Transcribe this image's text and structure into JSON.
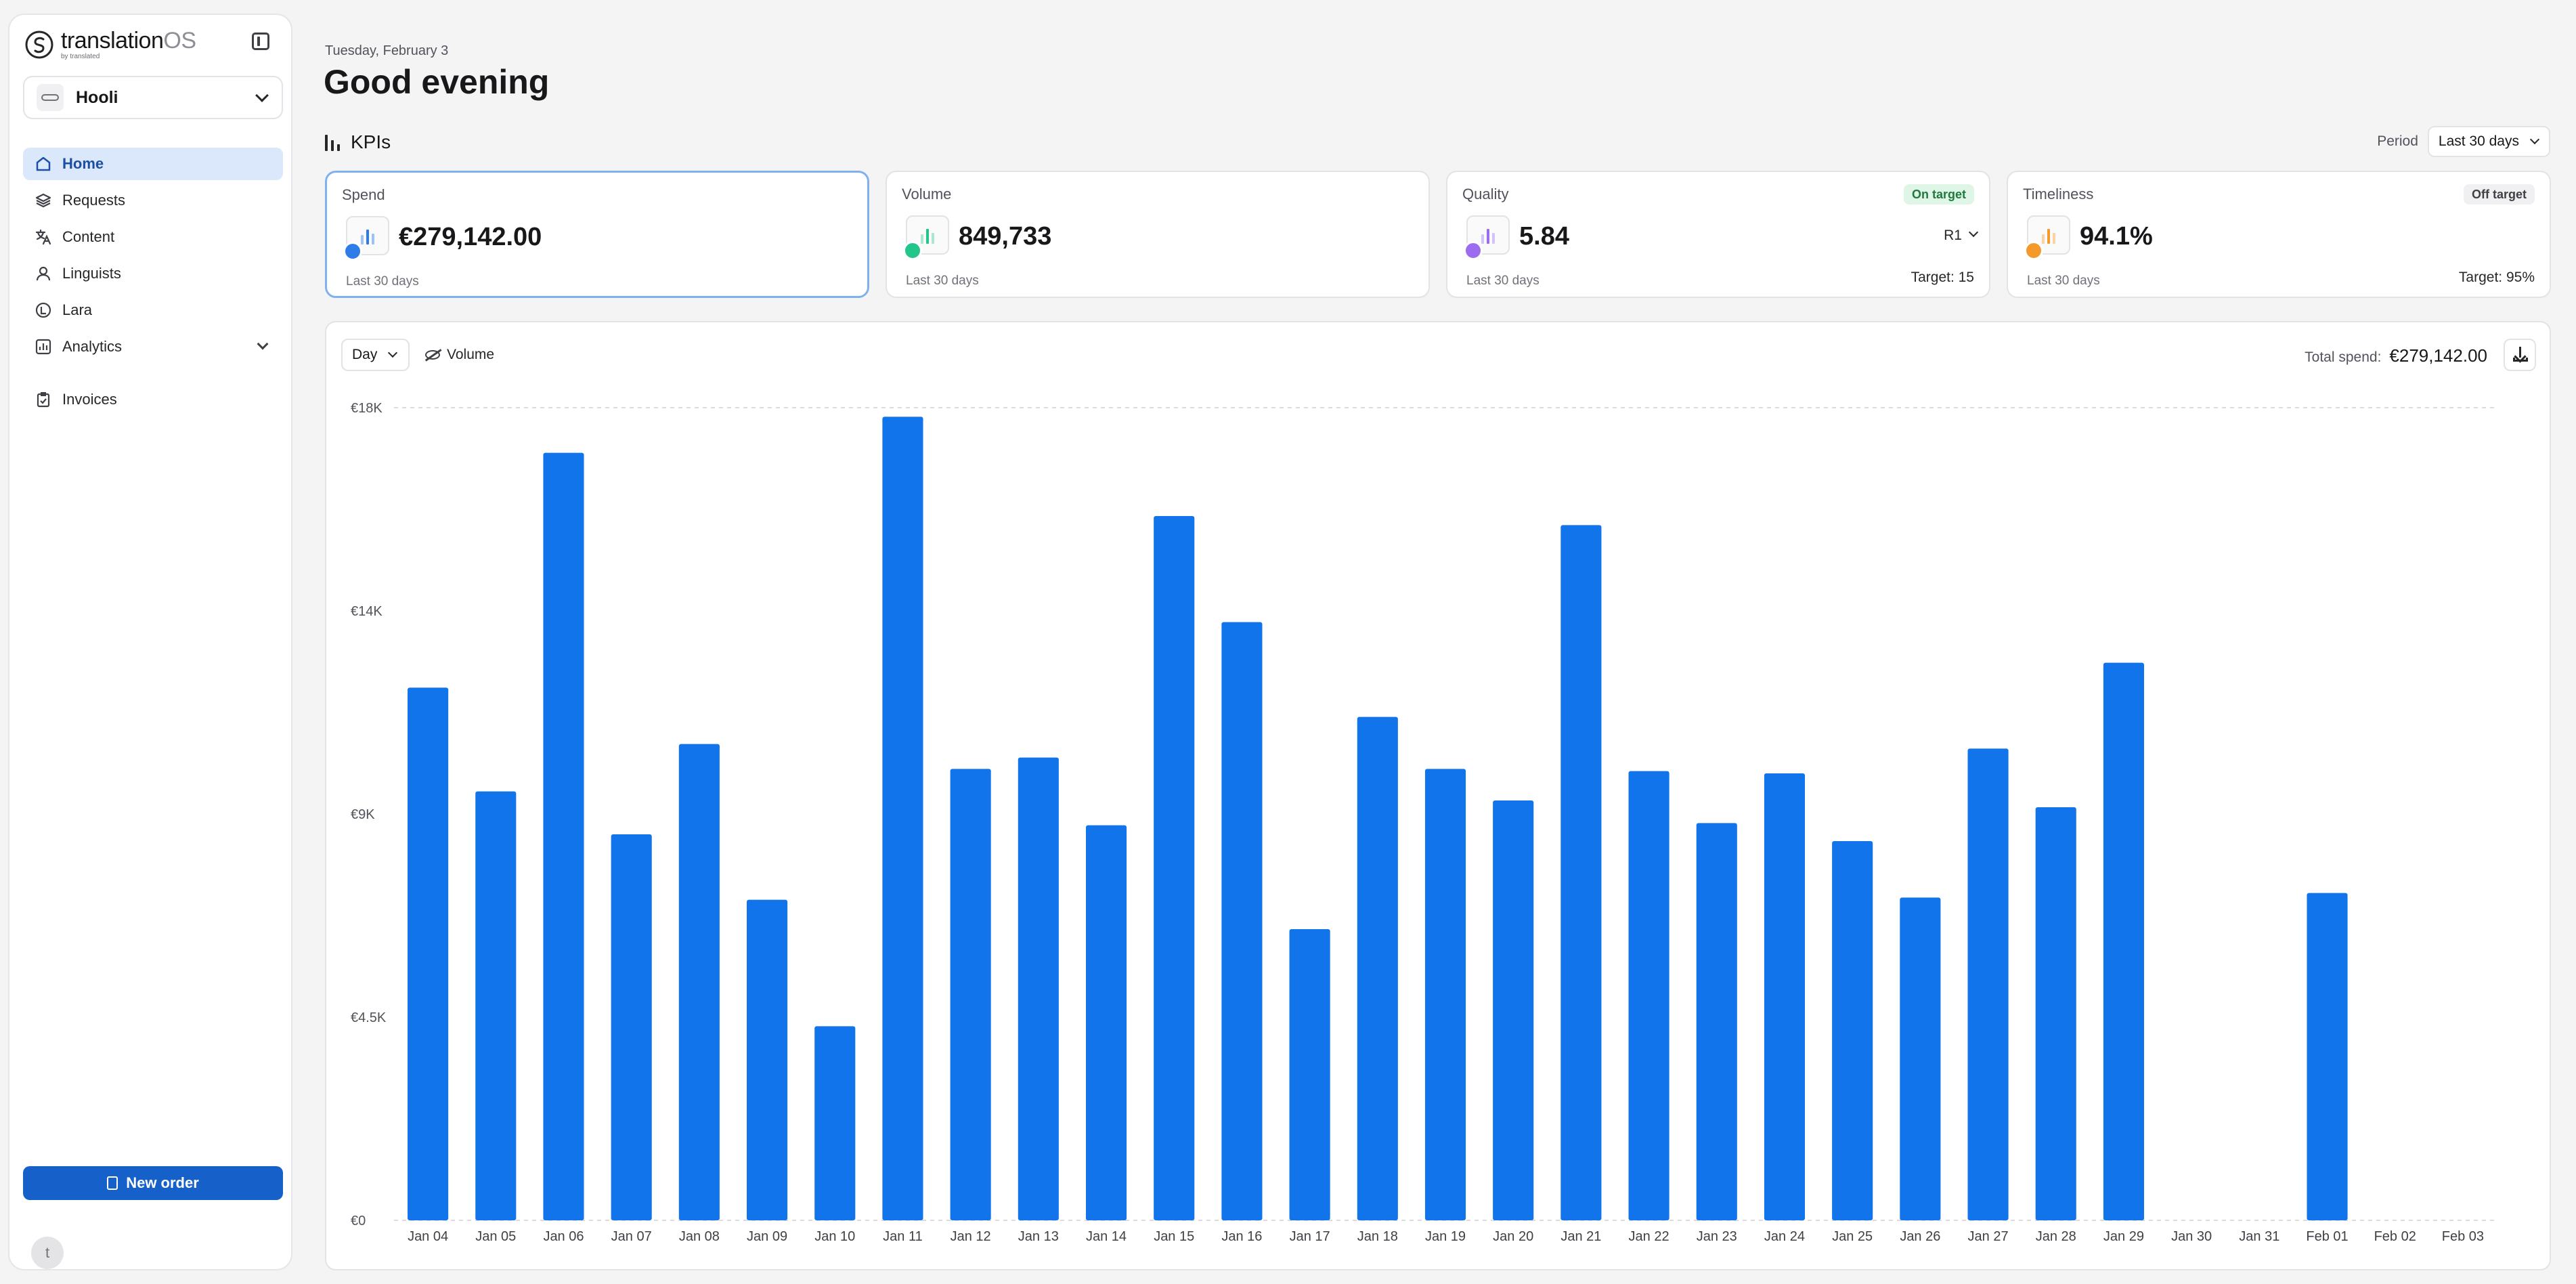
{
  "brand": {
    "name_main": "translation",
    "name_os": "OS",
    "byline": "by translated"
  },
  "org": {
    "name": "Hooli"
  },
  "nav": [
    {
      "label": "Home",
      "icon": "home-icon",
      "active": true
    },
    {
      "label": "Requests",
      "icon": "layers-icon"
    },
    {
      "label": "Content",
      "icon": "translate-icon"
    },
    {
      "label": "Linguists",
      "icon": "user-icon"
    },
    {
      "label": "Lara",
      "icon": "lara-icon"
    },
    {
      "label": "Analytics",
      "icon": "analytics-icon"
    },
    {
      "label": "Invoices",
      "icon": "clipboard-icon"
    }
  ],
  "new_order_label": "New order",
  "user": {
    "initial": "t"
  },
  "header": {
    "date": "Tuesday, February 3",
    "greeting": "Good evening"
  },
  "kpis": {
    "title": "KPIs",
    "period_label": "Period",
    "period_value": "Last 30 days",
    "cards": [
      {
        "label": "Spend",
        "value": "€279,142.00",
        "sub": "Last 30 days",
        "color": "#2f7be8"
      },
      {
        "label": "Volume",
        "value": "849,733",
        "sub": "Last 30 days",
        "color": "#22c58a"
      },
      {
        "label": "Quality",
        "value": "5.84",
        "sub": "Last 30 days",
        "color": "#9b6cf0",
        "badge": "On target",
        "selector": "R1",
        "target": "Target: 15"
      },
      {
        "label": "Timeliness",
        "value": "94.1%",
        "sub": "Last 30 days",
        "color": "#f39a2a",
        "badge": "Off target",
        "target": "Target: 95%"
      }
    ]
  },
  "chart_controls": {
    "granularity": "Day",
    "volume_toggle": "Volume",
    "total_label": "Total spend:",
    "total_value": "€279,142.00"
  },
  "colors": {
    "accent": "#1174ea",
    "primary_button": "#1560c9"
  },
  "chart_data": {
    "type": "bar",
    "title": "",
    "xlabel": "",
    "ylabel": "",
    "ylim": [
      0,
      18000
    ],
    "y_ticks": [
      "€0",
      "€4.5K",
      "€9K",
      "€14K",
      "€18K"
    ],
    "y_tick_values": [
      0,
      4500,
      9000,
      13500,
      18000
    ],
    "grid": "top dashed line",
    "categories": [
      "Jan 04",
      "Jan 05",
      "Jan 06",
      "Jan 07",
      "Jan 08",
      "Jan 09",
      "Jan 10",
      "Jan 11",
      "Jan 12",
      "Jan 13",
      "Jan 14",
      "Jan 15",
      "Jan 16",
      "Jan 17",
      "Jan 18",
      "Jan 19",
      "Jan 20",
      "Jan 21",
      "Jan 22",
      "Jan 23",
      "Jan 24",
      "Jan 25",
      "Jan 26",
      "Jan 27",
      "Jan 28",
      "Jan 29",
      "Jan 30",
      "Jan 31",
      "Feb 01",
      "Feb 02",
      "Feb 03"
    ],
    "values": [
      11800,
      9500,
      17000,
      8550,
      10550,
      7100,
      4300,
      17800,
      10000,
      10250,
      8750,
      15600,
      13250,
      6450,
      11150,
      10000,
      9300,
      15400,
      9950,
      8800,
      9900,
      8400,
      7150,
      10450,
      9150,
      12350,
      0,
      0,
      7250,
      0,
      0
    ]
  }
}
